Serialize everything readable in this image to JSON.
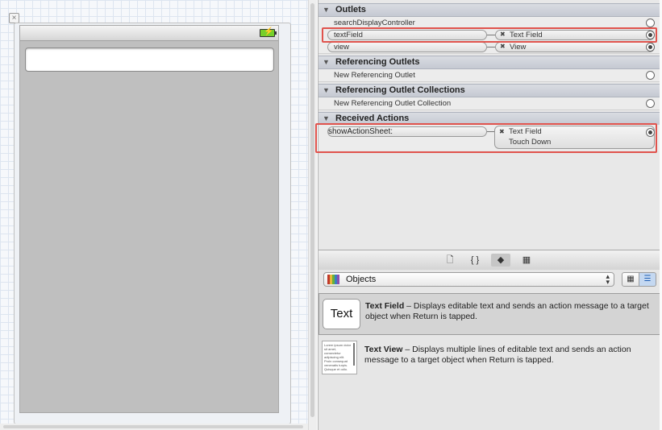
{
  "outlets": {
    "header": "Outlets",
    "rows": [
      {
        "name": "searchDisplayController",
        "target": "",
        "connected": false
      },
      {
        "name": "textField",
        "target": "Text Field",
        "connected": true
      },
      {
        "name": "view",
        "target": "View",
        "connected": true
      }
    ]
  },
  "referencing_outlets": {
    "header": "Referencing Outlets",
    "rows": [
      {
        "name": "New Referencing Outlet"
      }
    ]
  },
  "referencing_outlet_collections": {
    "header": "Referencing Outlet Collections",
    "rows": [
      {
        "name": "New Referencing Outlet Collection"
      }
    ]
  },
  "received_actions": {
    "header": "Received Actions",
    "action": {
      "name": "showActionSheet:",
      "target": "Text Field",
      "event": "Touch Down"
    }
  },
  "library": {
    "tabs": [
      "file-template-icon",
      "code-snippet-icon",
      "object-library-icon",
      "media-library-icon"
    ],
    "popup_label": "Objects",
    "items": [
      {
        "thumb": "Text",
        "title": "Text Field",
        "desc": " – Displays editable text and sends an action message to a target object when Return is tapped."
      },
      {
        "thumb": "Lorem ipsum dolor sit amet, consectetur adipiscing elit. Proin consequat venenatis turpis. Quisque et odio.",
        "title": "Text View",
        "desc": " – Displays multiple lines of editable text and sends an action message to a target object when Return is tapped."
      }
    ]
  },
  "colors": {
    "highlight": "#e0534d",
    "battery": "#76d02a",
    "selected_view": "#c4d8f1"
  }
}
